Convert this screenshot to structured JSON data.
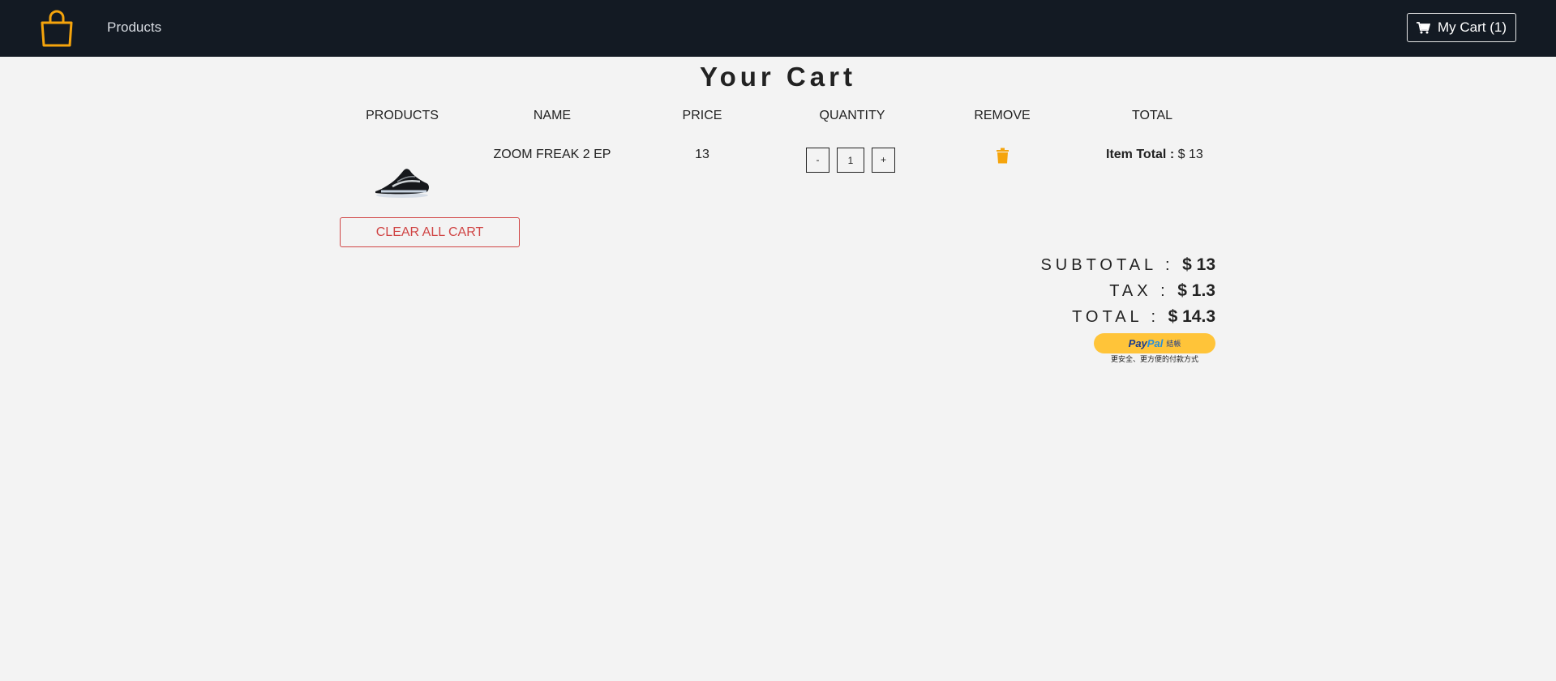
{
  "nav": {
    "logo_icon": "shopping-bag-icon",
    "products_link": "Products",
    "cart_button": "My Cart (1)",
    "cart_icon": "cart-icon"
  },
  "page": {
    "title": "Your Cart"
  },
  "table": {
    "headers": [
      "PRODUCTS",
      "NAME",
      "PRICE",
      "QUANTITY",
      "REMOVE",
      "TOTAL"
    ],
    "rows": [
      {
        "image": "sneaker-image",
        "name": "ZOOM FREAK 2 EP",
        "price": "13",
        "qty_minus": "-",
        "quantity": "1",
        "qty_plus": "+",
        "remove_icon": "trash-icon",
        "item_total_label": "Item Total :",
        "item_total_value": "$ 13"
      }
    ]
  },
  "actions": {
    "clear_cart": "CLEAR ALL CART"
  },
  "summary": {
    "subtotal_label": "SUBTOTAL :",
    "subtotal_value": "$ 13",
    "tax_label": "TAX :",
    "tax_value": "$ 1.3",
    "total_label": "TOTAL :",
    "total_value": "$ 14.3"
  },
  "paypal": {
    "pay": "Pay",
    "pal": "Pal",
    "action": "結帳",
    "tagline": "更安全、更方便的付款方式"
  },
  "colors": {
    "navbar_bg": "#131a23",
    "accent_orange": "#f5a40c",
    "danger": "#d04545",
    "paypal_yellow": "#ffc439"
  }
}
